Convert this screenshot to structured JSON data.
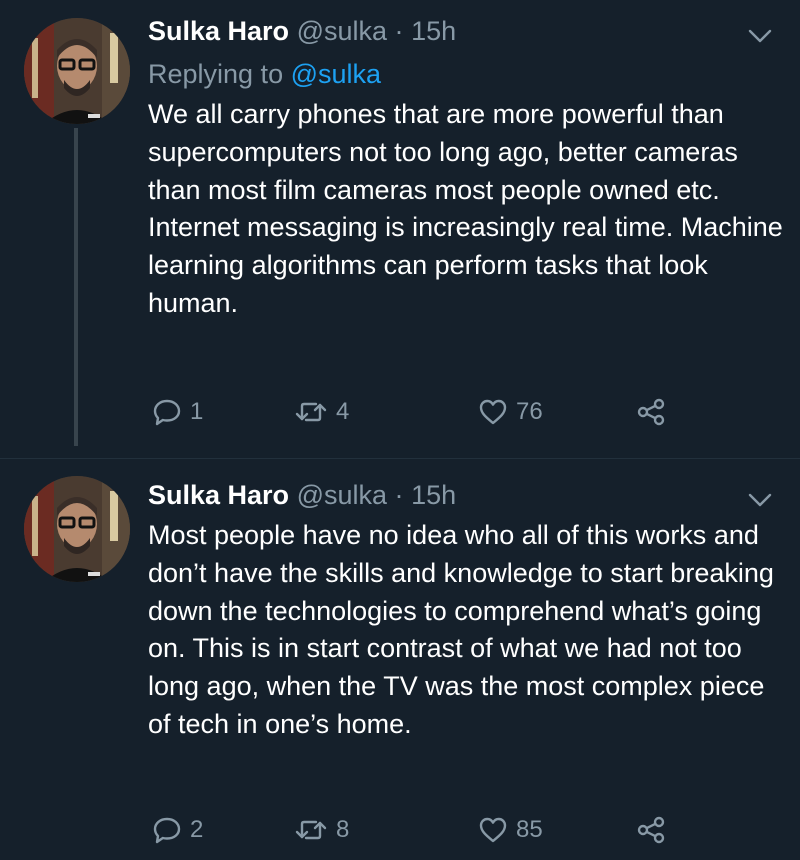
{
  "tweets": [
    {
      "author": "Sulka Haro",
      "handle": "@sulka",
      "separator": "·",
      "time": "15h",
      "replying_prefix": "Replying to",
      "replying_to": "@sulka",
      "text": "We all carry phones that are more powerful than supercomputers not too long ago, better cameras than most film cameras most people owned etc. Internet messaging is increasingly real time. Machine learning algorithms can perform tasks that look human.",
      "replies": "1",
      "retweets": "4",
      "likes": "76"
    },
    {
      "author": "Sulka Haro",
      "handle": "@sulka",
      "separator": "·",
      "time": "15h",
      "text": "Most people have no idea who all of this works and don’t have the skills and knowledge to start breaking down the technologies to comprehend what’s going on. This is in start contrast of what we had not too long ago, when the TV was the most complex piece of tech in one’s home.",
      "replies": "2",
      "retweets": "8",
      "likes": "85"
    }
  ],
  "icons": {
    "reply": "reply-icon",
    "retweet": "retweet-icon",
    "like": "heart-icon",
    "share": "share-icon",
    "more": "chevron-down-icon"
  },
  "colors": {
    "background": "#15202b",
    "secondary_text": "#8899a6",
    "link": "#1da1f2",
    "thread_line": "#38444d"
  }
}
